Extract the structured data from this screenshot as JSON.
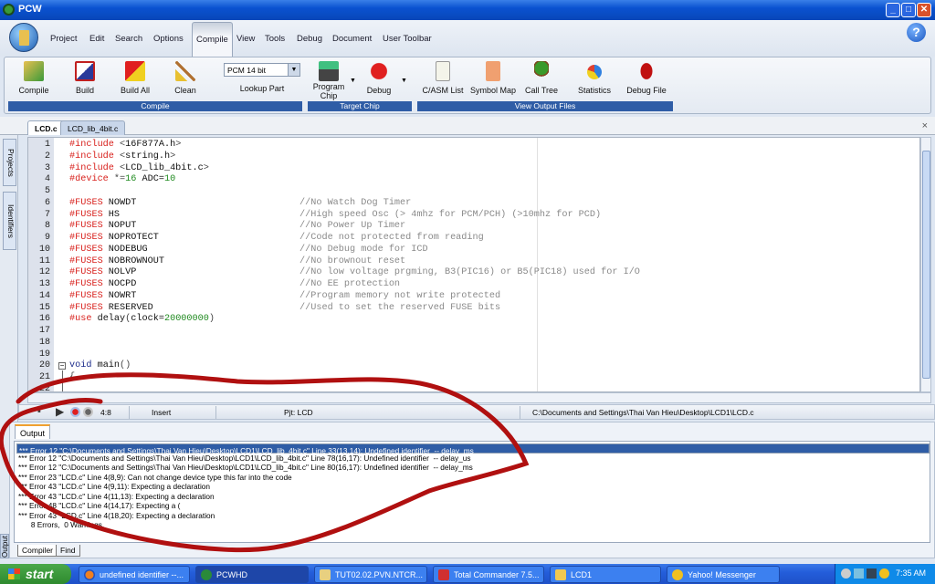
{
  "window": {
    "title": "PCW",
    "min": "_",
    "max": "□",
    "close": "✕"
  },
  "menu": {
    "items": [
      "Project",
      "Edit",
      "Search",
      "Options",
      "Compile",
      "View",
      "Tools",
      "Debug",
      "Document",
      "User Toolbar"
    ],
    "active": "Compile",
    "help": "?"
  },
  "ribbon": {
    "compile_group": {
      "label": "Compile",
      "buttons": [
        "Compile",
        "Build",
        "Build All",
        "Clean"
      ]
    },
    "part": {
      "selected": "PCM 14 bit",
      "lookup": "Lookup Part"
    },
    "target_group": {
      "label": "Target Chip",
      "program": "Program Chip",
      "debug": "Debug"
    },
    "view_group": {
      "label": "View Output Files",
      "buttons": [
        "C/ASM List",
        "Symbol Map",
        "Call Tree",
        "Statistics",
        "Debug File"
      ]
    }
  },
  "tabs": [
    {
      "label": "LCD.c",
      "active": true
    },
    {
      "label": "LCD_lib_4bit.c",
      "active": false
    }
  ],
  "tab_close": "×",
  "sidebar": {
    "tabs": [
      "Projects",
      "Identifiers"
    ]
  },
  "code": [
    [
      {
        "t": "#include ",
        "c": "pp"
      },
      {
        "t": "<",
        "c": "str"
      },
      {
        "t": "16F877A.h",
        "c": "tx"
      },
      {
        "t": ">",
        "c": "str"
      }
    ],
    [
      {
        "t": "#include ",
        "c": "pp"
      },
      {
        "t": "<",
        "c": "str"
      },
      {
        "t": "string.h",
        "c": "tx"
      },
      {
        "t": ">",
        "c": "str"
      }
    ],
    [
      {
        "t": "#include ",
        "c": "pp"
      },
      {
        "t": "<",
        "c": "str"
      },
      {
        "t": "LCD_lib_4bit.c",
        "c": "tx"
      },
      {
        "t": ">",
        "c": "str"
      }
    ],
    [
      {
        "t": "#device ",
        "c": "pp"
      },
      {
        "t": "*=",
        "c": "str"
      },
      {
        "t": "16",
        "c": "num"
      },
      {
        "t": " ADC=",
        "c": "tx"
      },
      {
        "t": "10",
        "c": "num"
      }
    ],
    [],
    [
      {
        "t": "#FUSES ",
        "c": "pp"
      },
      {
        "t": "NOWDT",
        "c": "tx"
      },
      {
        "t": "//No Watch Dog Timer",
        "c": "cm"
      }
    ],
    [
      {
        "t": "#FUSES ",
        "c": "pp"
      },
      {
        "t": "HS",
        "c": "tx"
      },
      {
        "t": "//High speed Osc (> 4mhz for PCM/PCH) (>10mhz for PCD)",
        "c": "cm"
      }
    ],
    [
      {
        "t": "#FUSES ",
        "c": "pp"
      },
      {
        "t": "NOPUT",
        "c": "tx"
      },
      {
        "t": "//No Power Up Timer",
        "c": "cm"
      }
    ],
    [
      {
        "t": "#FUSES ",
        "c": "pp"
      },
      {
        "t": "NOPROTECT",
        "c": "tx"
      },
      {
        "t": "//Code not protected from reading",
        "c": "cm"
      }
    ],
    [
      {
        "t": "#FUSES ",
        "c": "pp"
      },
      {
        "t": "NODEBUG",
        "c": "tx"
      },
      {
        "t": "//No Debug mode for ICD",
        "c": "cm"
      }
    ],
    [
      {
        "t": "#FUSES ",
        "c": "pp"
      },
      {
        "t": "NOBROWNOUT",
        "c": "tx"
      },
      {
        "t": "//No brownout reset",
        "c": "cm"
      }
    ],
    [
      {
        "t": "#FUSES ",
        "c": "pp"
      },
      {
        "t": "NOLVP",
        "c": "tx"
      },
      {
        "t": "//No low voltage prgming, B3(PIC16) or B5(PIC18) used for I/O",
        "c": "cm"
      }
    ],
    [
      {
        "t": "#FUSES ",
        "c": "pp"
      },
      {
        "t": "NOCPD",
        "c": "tx"
      },
      {
        "t": "//No EE protection",
        "c": "cm"
      }
    ],
    [
      {
        "t": "#FUSES ",
        "c": "pp"
      },
      {
        "t": "NOWRT",
        "c": "tx"
      },
      {
        "t": "//Program memory not write protected",
        "c": "cm"
      }
    ],
    [
      {
        "t": "#FUSES ",
        "c": "pp"
      },
      {
        "t": "RESERVED",
        "c": "tx"
      },
      {
        "t": "//Used to set the reserved FUSE bits",
        "c": "cm"
      }
    ],
    [
      {
        "t": "#use ",
        "c": "pp"
      },
      {
        "t": "delay",
        "c": "tx"
      },
      {
        "t": "(",
        "c": "str"
      },
      {
        "t": "clock=",
        "c": "tx"
      },
      {
        "t": "20000000",
        "c": "num"
      },
      {
        "t": ")",
        "c": "str"
      }
    ],
    [],
    [],
    [],
    [
      {
        "t": "void ",
        "c": "kw"
      },
      {
        "t": "main",
        "c": "tx"
      },
      {
        "t": "()",
        "c": "str"
      }
    ],
    [
      {
        "t": "{",
        "c": "str"
      }
    ],
    []
  ],
  "status": {
    "position": "4:8",
    "mode": "Insert",
    "project": "Pjt: LCD",
    "path": "C:\\Documents and Settings\\Thai Van Hieu\\Desktop\\LCD1\\LCD.c"
  },
  "output": {
    "tab": "Output",
    "side_label": "Output",
    "rows": [
      "*** Error 12 \"C:\\Documents and Settings\\Thai Van Hieu\\Desktop\\LCD1\\LCD_lib_4bit.c\" Line 33(13,14): Undefined identifier  -- delay_ms",
      "*** Error 12 \"C:\\Documents and Settings\\Thai Van Hieu\\Desktop\\LCD1\\LCD_lib_4bit.c\" Line 78(16,17): Undefined identifier  -- delay_us",
      "*** Error 12 \"C:\\Documents and Settings\\Thai Van Hieu\\Desktop\\LCD1\\LCD_lib_4bit.c\" Line 80(16,17): Undefined identifier  -- delay_ms",
      "*** Error 23 \"LCD.c\" Line 4(8,9): Can not change device type this far into the code",
      "*** Error 43 \"LCD.c\" Line 4(9,11): Expecting a declaration",
      "*** Error 43 \"LCD.c\" Line 4(11,13): Expecting a declaration",
      "*** Error 48 \"LCD.c\" Line 4(14,17): Expecting a (",
      "*** Error 43 \"LCD.c\" Line 4(18,20): Expecting a declaration",
      "      8 Errors,  0 Warnings."
    ],
    "bottom_tabs": [
      "Compiler",
      "Find"
    ]
  },
  "taskbar": {
    "start": "start",
    "tasks": [
      "undefined identifier --...",
      "PCWHD",
      "TUT02.02.PVN.NTCR...",
      "Total Commander 7.5...",
      "LCD1",
      "Yahoo! Messenger"
    ],
    "clock": "7:35 AM"
  },
  "colors": {
    "annotation": "#b01010",
    "ribbon_label": "#2f5da6",
    "title": "#0a52d0"
  }
}
